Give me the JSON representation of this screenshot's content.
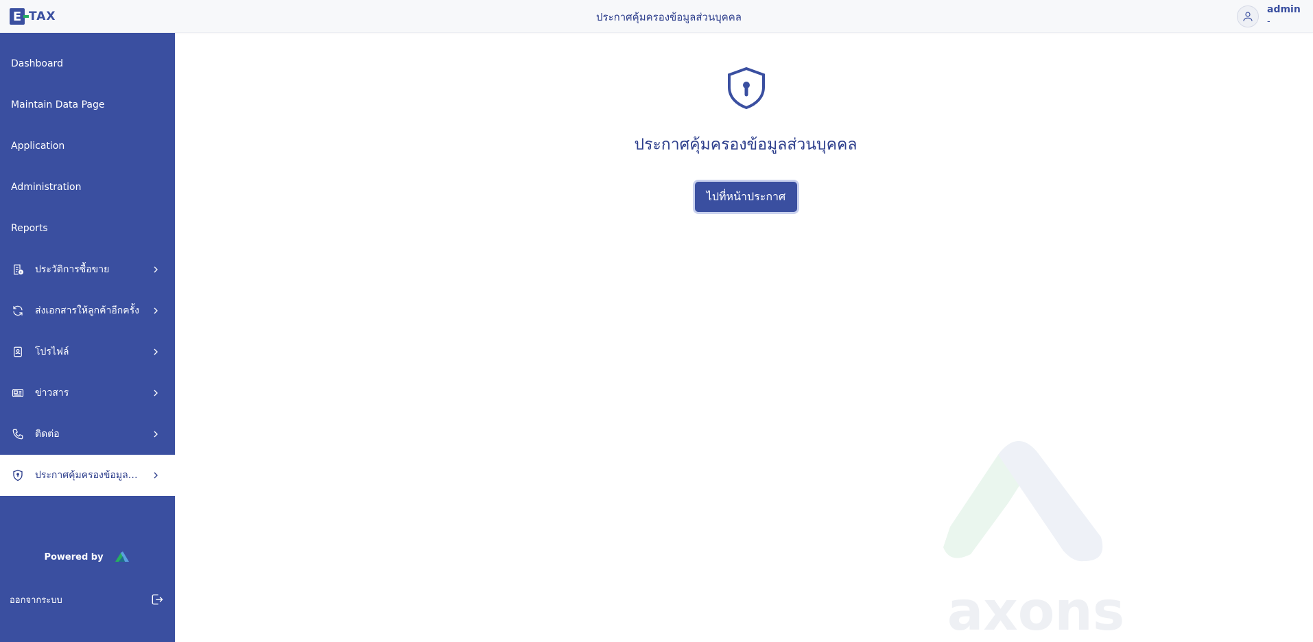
{
  "header": {
    "logo_letter": "E",
    "logo_text": "TAX",
    "title": "ประกาศคุ้มครองข้อมูลส่วนบุคคล",
    "user_name": "admin",
    "user_sub": "-"
  },
  "sidebar": {
    "items": [
      {
        "label": "Dashboard",
        "icon": "none"
      },
      {
        "label": "Maintain Data Page",
        "icon": "none"
      },
      {
        "label": "Application",
        "icon": "none"
      },
      {
        "label": "Administration",
        "icon": "none"
      },
      {
        "label": "Reports",
        "icon": "none"
      },
      {
        "label": "ประวัติการซื้อขาย",
        "icon": "receipt-icon"
      },
      {
        "label": "ส่งเอกสารให้ลูกค้าอีกครั้ง",
        "icon": "refresh-icon"
      },
      {
        "label": "โปรไฟล์",
        "icon": "profile-card-icon"
      },
      {
        "label": "ข่าวสาร",
        "icon": "news-icon"
      },
      {
        "label": "ติดต่อ",
        "icon": "phone-icon"
      },
      {
        "label": "ประกาศคุ้มครองข้อมูลส่...",
        "icon": "shield-icon"
      }
    ],
    "powered_by": "Powered by",
    "logout_label": "ออกจากระบบ"
  },
  "main": {
    "title": "ประกาศคุ้มครองข้อมูลส่วนบุคคล",
    "button_label": "ไปที่หน้าประกาศ",
    "watermark_text": "axons"
  },
  "colors": {
    "primary": "#3a4fa0",
    "text": "#2d3e8c",
    "accent_green": "#27ae60"
  }
}
